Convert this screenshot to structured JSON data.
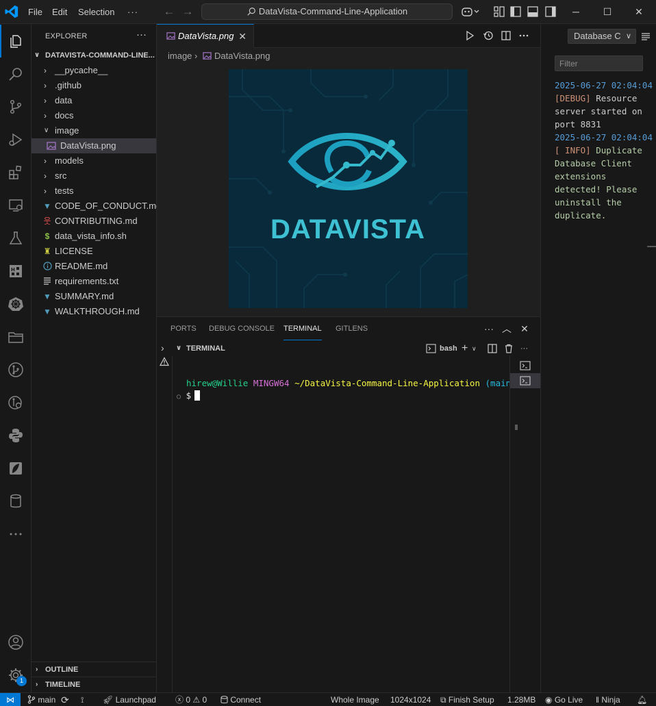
{
  "titlebar": {
    "menus": [
      "File",
      "Edit",
      "Selection"
    ],
    "more": "···",
    "search_text": "DataVista-Command-Line-Application"
  },
  "explorer": {
    "header": "EXPLORER",
    "more": "···",
    "root": "DATAVISTA-COMMAND-LINE...",
    "items": [
      {
        "label": "__pycache__",
        "type": "folder",
        "expanded": false
      },
      {
        "label": ".github",
        "type": "folder",
        "expanded": false
      },
      {
        "label": "data",
        "type": "folder",
        "expanded": false
      },
      {
        "label": "docs",
        "type": "folder",
        "expanded": false
      },
      {
        "label": "image",
        "type": "folder",
        "expanded": true
      },
      {
        "label": "DataVista.png",
        "type": "image-file",
        "selected": true
      },
      {
        "label": "models",
        "type": "folder",
        "expanded": false
      },
      {
        "label": "src",
        "type": "folder",
        "expanded": false
      },
      {
        "label": "tests",
        "type": "folder",
        "expanded": false
      },
      {
        "label": "CODE_OF_CONDUCT.md",
        "type": "markdown-file"
      },
      {
        "label": "CONTRIBUTING.md",
        "type": "contributing-file"
      },
      {
        "label": "data_vista_info.sh",
        "type": "shell-file"
      },
      {
        "label": "LICENSE",
        "type": "license-file"
      },
      {
        "label": "README.md",
        "type": "readme-file"
      },
      {
        "label": "requirements.txt",
        "type": "text-file"
      },
      {
        "label": "SUMMARY.md",
        "type": "markdown-file"
      },
      {
        "label": "WALKTHROUGH.md",
        "type": "markdown-file"
      }
    ],
    "sections": [
      "OUTLINE",
      "TIMELINE"
    ]
  },
  "editor": {
    "tab_label": "DataVista.png",
    "breadcrumb": [
      "image",
      "DataVista.png"
    ],
    "preview_logo_text": "DATAVISTA"
  },
  "panel": {
    "tabs": [
      "PORTS",
      "DEBUG CONSOLE",
      "TERMINAL",
      "GITLENS"
    ],
    "active_tab": "TERMINAL",
    "terminal_header": "TERMINAL",
    "shell": "bash",
    "prompt_user": "hirew@Willie",
    "prompt_sys": "MINGW64",
    "prompt_path": "~/DataVista-Command-Line-Application",
    "prompt_branch": "(main)",
    "prompt_symbol": "$"
  },
  "output": {
    "selector": "Database C",
    "filter_placeholder": "Filter",
    "entries": [
      {
        "timestamp": "2025-06-27 02:04:04",
        "level": "[DEBUG]",
        "message": "Resource server started on port 8831"
      },
      {
        "timestamp": "2025-06-27 02:04:04",
        "level": "[ INFO]",
        "message": "Duplicate Database Client extensions detected! Please uninstall the duplicate."
      }
    ]
  },
  "statusbar": {
    "branch": "main",
    "launchpad": "Launchpad",
    "errors": "0",
    "warnings": "0",
    "connect": "Connect",
    "image_mode": "Whole Image",
    "dimensions": "1024x1024",
    "finish_setup": "Finish Setup",
    "size": "1.28MB",
    "go_live": "Go Live",
    "ninja": "Ninja"
  },
  "accounts_badge": "1",
  "colors": {
    "accent": "#0078d4",
    "prompt_user": "#23d18b",
    "prompt_sys": "#d670d6",
    "prompt_path": "#f5f543",
    "prompt_branch": "#29b8db",
    "logo_text": "#3ec1d3"
  }
}
